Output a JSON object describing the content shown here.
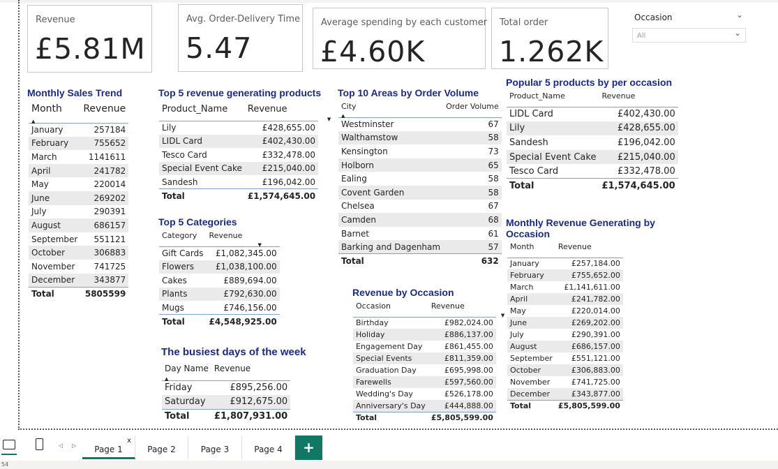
{
  "kpis": [
    {
      "label": "Revenue",
      "value": "£5.81M"
    },
    {
      "label": "Avg. Order-Delivery Time",
      "value": "5.47"
    },
    {
      "label": "Average spending by each customer",
      "value": "£4.60K"
    },
    {
      "label": "Total order",
      "value": "1.262K"
    }
  ],
  "slicer": {
    "title": "Occasion",
    "value": "All"
  },
  "monthly_sales": {
    "title": "Monthly Sales Trend",
    "headers": [
      "Month",
      "Revenue"
    ],
    "rows": [
      [
        "January",
        "257184"
      ],
      [
        "February",
        "755652"
      ],
      [
        "March",
        "1141611"
      ],
      [
        "April",
        "241782"
      ],
      [
        "May",
        "220014"
      ],
      [
        "June",
        "269202"
      ],
      [
        "July",
        "290391"
      ],
      [
        "August",
        "686157"
      ],
      [
        "September",
        "551121"
      ],
      [
        "October",
        "306883"
      ],
      [
        "November",
        "741725"
      ],
      [
        "December",
        "343877"
      ]
    ],
    "total": [
      "Total",
      "5805599"
    ]
  },
  "top5_products": {
    "title": "Top 5 revenue generating products",
    "headers": [
      "Product_Name",
      "Revenue"
    ],
    "rows": [
      [
        "Lily",
        "£428,655.00"
      ],
      [
        "LIDL Card",
        "£402,430.00"
      ],
      [
        "Tesco Card",
        "£332,478.00"
      ],
      [
        "Special Event Cake",
        "£215,040.00"
      ],
      [
        "Sandesh",
        "£196,042.00"
      ]
    ],
    "total": [
      "Total",
      "£1,574,645.00"
    ]
  },
  "top5_categories": {
    "title": "Top 5 Categories",
    "headers": [
      "Category",
      "Revenue"
    ],
    "rows": [
      [
        "Gift Cards",
        "£1,082,345.00"
      ],
      [
        "Flowers",
        "£1,038,100.00"
      ],
      [
        "Cakes",
        "£889,694.00"
      ],
      [
        "Plants",
        "£792,630.00"
      ],
      [
        "Mugs",
        "£746,156.00"
      ]
    ],
    "total": [
      "Total",
      "£4,548,925.00"
    ]
  },
  "busiest_days": {
    "title": "The busiest days of the week",
    "headers": [
      "Day Name",
      "Revenue"
    ],
    "rows": [
      [
        "Friday",
        "£895,256.00"
      ],
      [
        "Saturday",
        "£912,675.00"
      ]
    ],
    "total": [
      "Total",
      "£1,807,931.00"
    ]
  },
  "top10_areas": {
    "title": "Top 10 Areas by Order Volume",
    "headers": [
      "City",
      "Order Volume"
    ],
    "rows": [
      [
        "Westminster",
        "67"
      ],
      [
        "Walthamstow",
        "58"
      ],
      [
        "Kensington",
        "73"
      ],
      [
        "Holborn",
        "65"
      ],
      [
        "Ealing",
        "58"
      ],
      [
        "Covent Garden",
        "58"
      ],
      [
        "Chelsea",
        "67"
      ],
      [
        "Camden",
        "68"
      ],
      [
        "Barnet",
        "61"
      ],
      [
        "Barking and Dagenham",
        "57"
      ]
    ],
    "total": [
      "Total",
      "632"
    ]
  },
  "revenue_occasion": {
    "title": "Revenue by Occasion",
    "headers": [
      "Occasion",
      "Revenue"
    ],
    "rows": [
      [
        "Birthday",
        "£982,024.00"
      ],
      [
        "Holiday",
        "£886,137.00"
      ],
      [
        "Engagement Day",
        "£861,455.00"
      ],
      [
        "Special Events",
        "£811,359.00"
      ],
      [
        "Graduation Day",
        "£695,998.00"
      ],
      [
        "Farewells",
        "£597,560.00"
      ],
      [
        "Wedding's Day",
        "£526,178.00"
      ],
      [
        "Anniversary's Day",
        "£444,888.00"
      ]
    ],
    "total": [
      "Total",
      "£5,805,599.00"
    ]
  },
  "popular5": {
    "title": "Popular 5 products by per occasion",
    "headers": [
      "Product_Name",
      "Revenue"
    ],
    "rows": [
      [
        "LIDL Card",
        "£402,430.00"
      ],
      [
        "Lily",
        "£428,655.00"
      ],
      [
        "Sandesh",
        "£196,042.00"
      ],
      [
        "Special Event Cake",
        "£215,040.00"
      ],
      [
        "Tesco Card",
        "£332,478.00"
      ]
    ],
    "total": [
      "Total",
      "£1,574,645.00"
    ]
  },
  "monthly_occasion": {
    "title_line1": "Monthly Revenue Generating by",
    "title_line2": "Occasion",
    "headers": [
      "Month",
      "Revenue"
    ],
    "rows": [
      [
        "January",
        "£257,184.00"
      ],
      [
        "February",
        "£755,652.00"
      ],
      [
        "March",
        "£1,141,611.00"
      ],
      [
        "April",
        "£241,782.00"
      ],
      [
        "May",
        "£220,014.00"
      ],
      [
        "June",
        "£269,202.00"
      ],
      [
        "July",
        "£290,391.00"
      ],
      [
        "August",
        "£686,157.00"
      ],
      [
        "September",
        "£551,121.00"
      ],
      [
        "October",
        "£306,883.00"
      ],
      [
        "November",
        "£741,725.00"
      ],
      [
        "December",
        "£343,877.00"
      ]
    ],
    "total": [
      "Total",
      "£5,805,599.00"
    ]
  },
  "tabs": [
    "Page 1",
    "Page 2",
    "Page 3",
    "Page 4"
  ],
  "tab_add_label": "+",
  "tab_close_label": "x",
  "status_text": "54",
  "accent": "#117865",
  "title_color": "#1a2a8c"
}
